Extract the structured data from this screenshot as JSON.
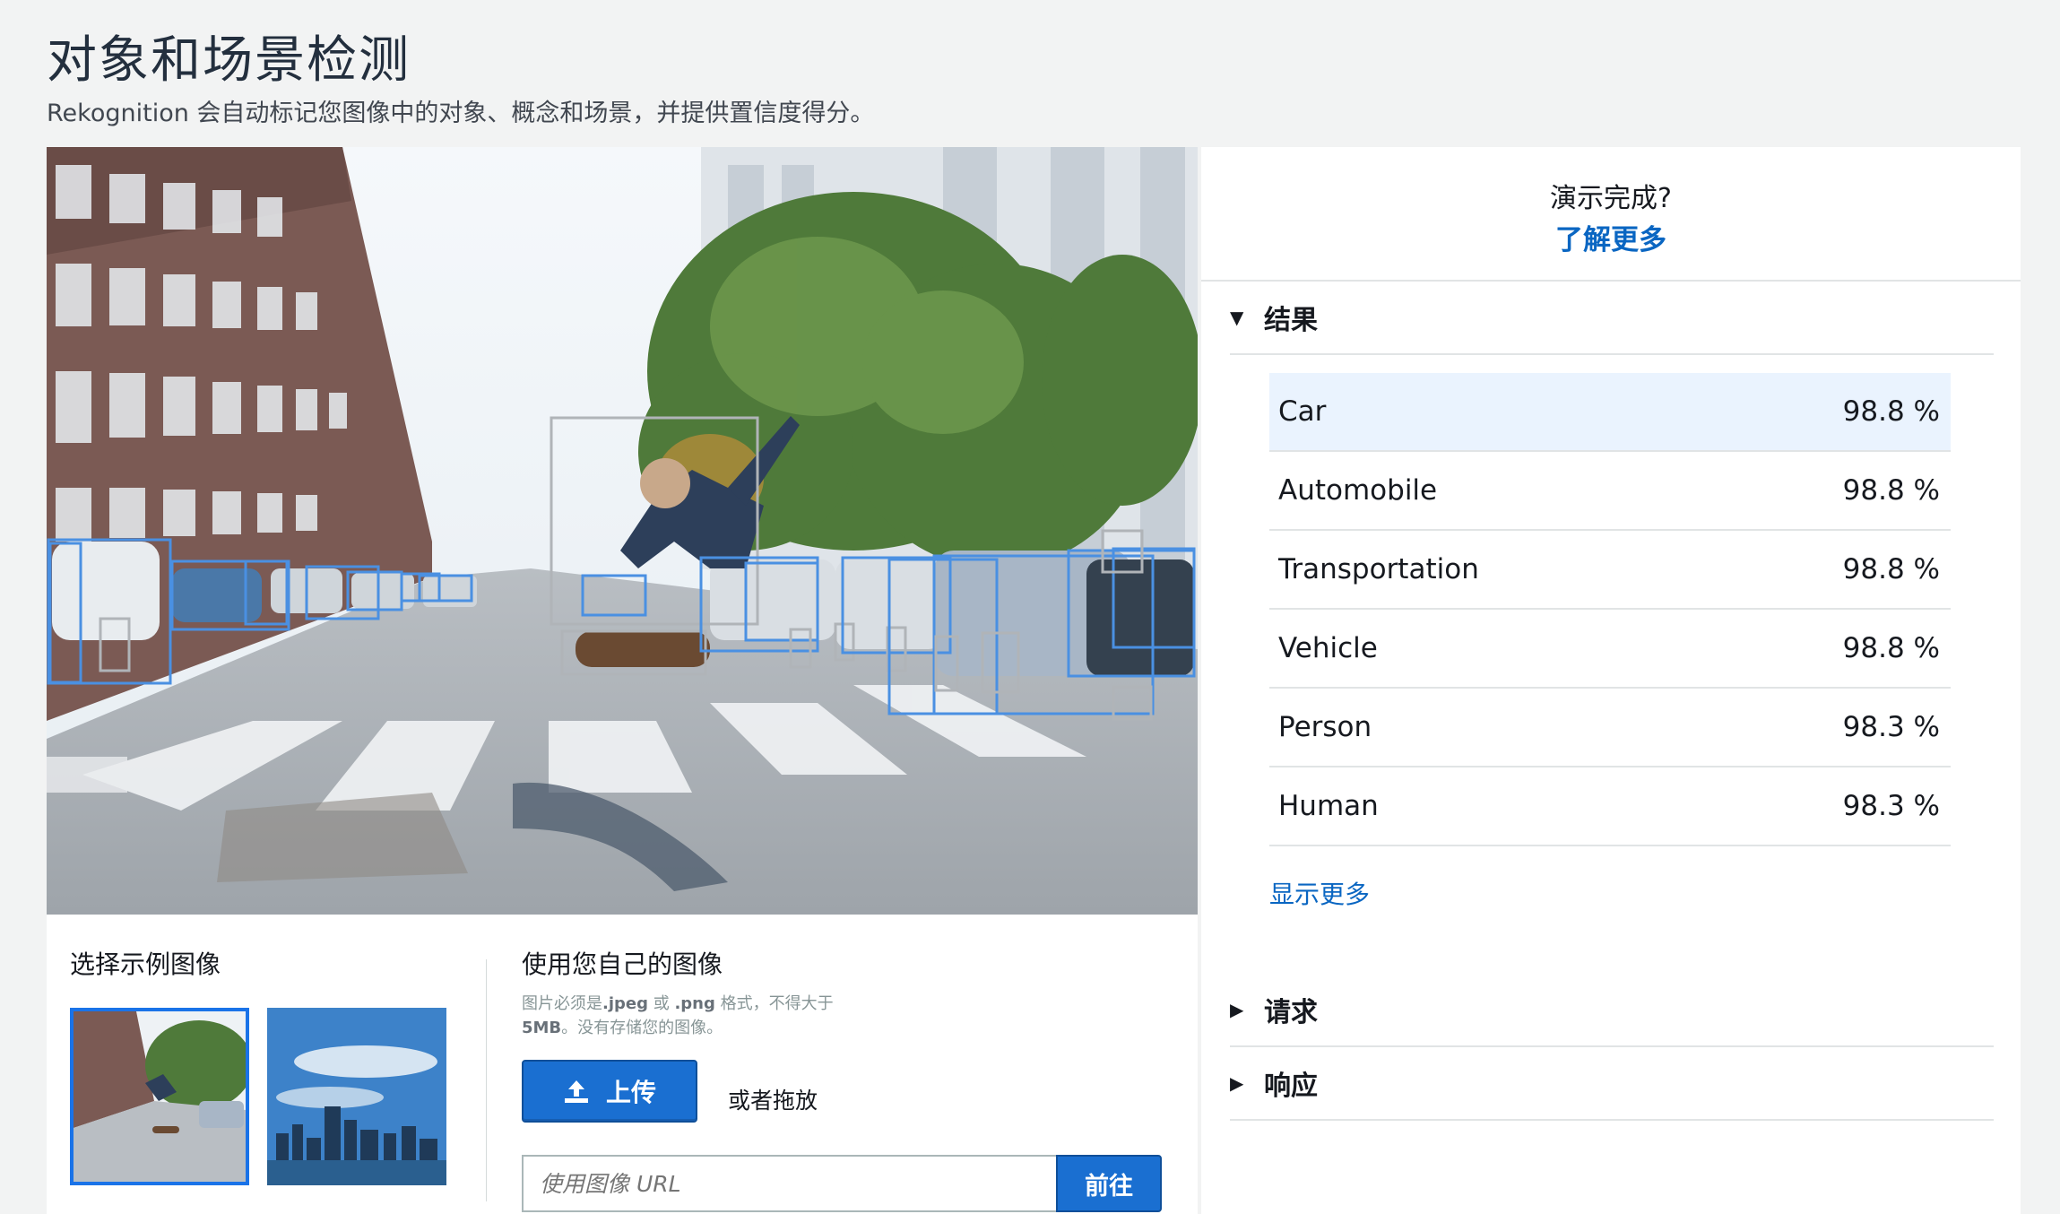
{
  "header": {
    "title": "对象和场景检测",
    "subtitle": "Rekognition 会自动标记您图像中的对象、概念和场景，并提供置信度得分。"
  },
  "samples": {
    "title": "选择示例图像",
    "items": [
      "skateboard-street-thumbnail",
      "city-skyline-thumbnail"
    ]
  },
  "own_image": {
    "title": "使用您自己的图像",
    "hint_line1_pre": "图片必须是",
    "hint_jpeg": ".jpeg",
    "hint_or": " 或 ",
    "hint_png": ".png",
    "hint_line1_post": " 格式，不得大于",
    "hint_size": "5MB",
    "hint_line2_post": "。没有存储您的图像。",
    "upload_label": "上传",
    "drag_text": "或者拖放",
    "url_placeholder": "使用图像 URL",
    "go_label": "前往"
  },
  "side": {
    "demo_question": "演示完成?",
    "learn_more": "了解更多",
    "results_header": "结果",
    "results": [
      {
        "label": "Car",
        "value": "98.8 %"
      },
      {
        "label": "Automobile",
        "value": "98.8 %"
      },
      {
        "label": "Transportation",
        "value": "98.8 %"
      },
      {
        "label": "Vehicle",
        "value": "98.8 %"
      },
      {
        "label": "Person",
        "value": "98.3 %"
      },
      {
        "label": "Human",
        "value": "98.3 %"
      }
    ],
    "show_more": "显示更多",
    "request_header": "请求",
    "response_header": "响应"
  },
  "colors": {
    "accent": "#0a66c2",
    "button": "#1a6fd1",
    "highlight_row": "#eaf3fe",
    "box_blue": "#4a90e2",
    "box_grey": "#b0b4b8"
  }
}
